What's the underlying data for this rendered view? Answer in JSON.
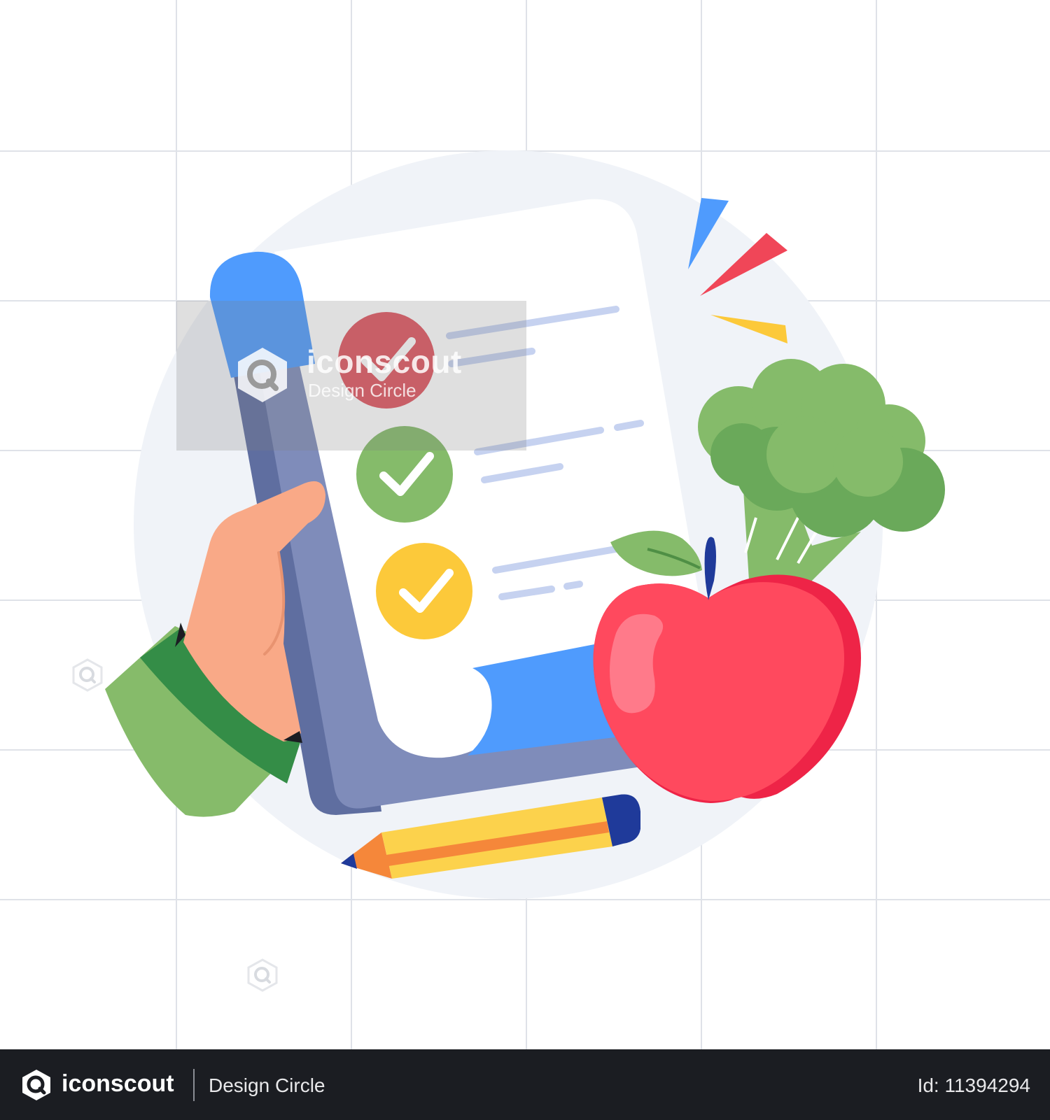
{
  "watermark": {
    "brand": "iconscout",
    "author": "Design Circle"
  },
  "footer": {
    "brand": "iconscout",
    "author": "Design Circle",
    "id_label": "Id: 11394294"
  },
  "illustration": {
    "checklist_items": [
      {
        "status": "done",
        "color": "#e0545f"
      },
      {
        "status": "done",
        "color": "#85bb6a"
      },
      {
        "status": "done",
        "color": "#fcc93a"
      }
    ],
    "colors": {
      "background_circle": "#f0f3f8",
      "clipboard": "#7f8cba",
      "clip": "#4f9bfd",
      "apple": "#f04658",
      "broccoli": "#85bb6a",
      "pencil": "#fcd24c",
      "sleeve": "#86bb6a",
      "hand": "#f9a987"
    }
  }
}
